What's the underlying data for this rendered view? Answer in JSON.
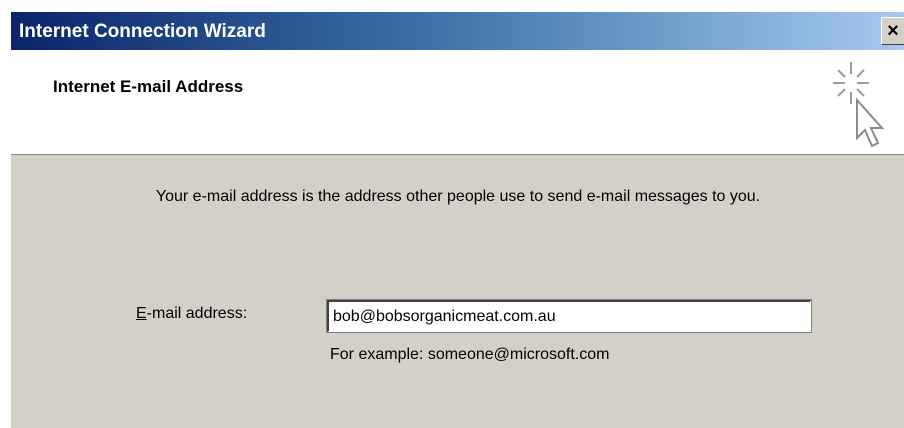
{
  "window": {
    "title": "Internet Connection Wizard",
    "close_glyph": "×"
  },
  "header": {
    "title": "Internet E-mail Address",
    "icon": "wizard-cursor-sparkle-icon"
  },
  "body": {
    "description": "Your e-mail address is the address other people use to send e-mail messages to you.",
    "email_label_accel": "E",
    "email_label_rest": "-mail address:",
    "email_value": "bob@bobsorganicmeat.com.au",
    "hint": "For example: someone@microsoft.com"
  },
  "colors": {
    "titlebar_start": "#0a246a",
    "titlebar_end": "#a6caf0",
    "dialog_bg": "#d4d0c8"
  }
}
